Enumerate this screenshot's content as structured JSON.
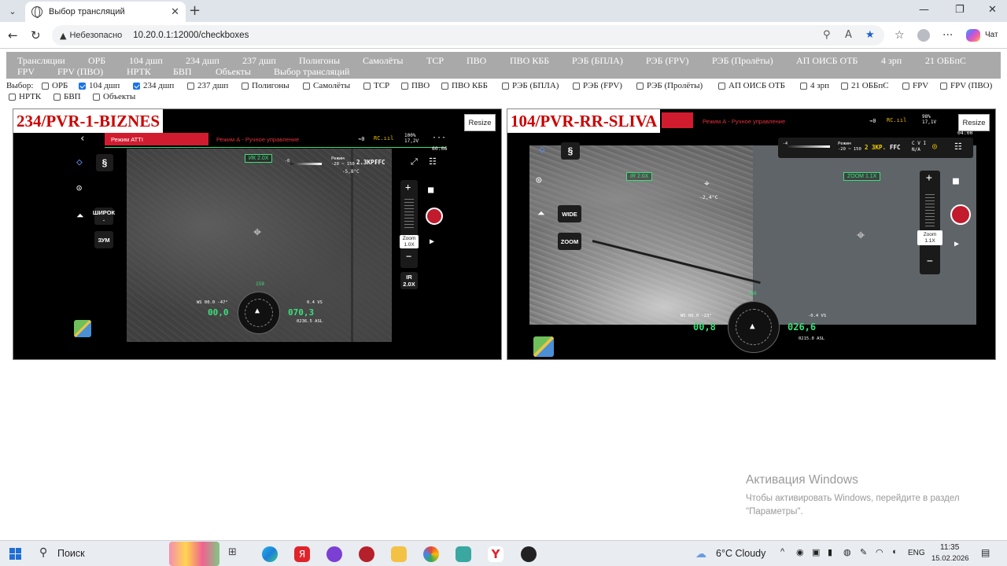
{
  "browser": {
    "tab_title": "Выбор трансляций",
    "insecure_label": "Небезопасно",
    "url": "10.20.0.1:12000/checkboxes",
    "chat_label": "Чат"
  },
  "nav_links": [
    "Трансляции",
    "ОРБ",
    "104 дшп",
    "234 дшп",
    "237 дшп",
    "Полигоны",
    "Самолёты",
    "ТСР",
    "ПВО",
    "ПВО КББ",
    "РЭБ (БПЛА)",
    "РЭБ (FPV)",
    "РЭБ (Пролёты)",
    "АП ОИСБ ОТБ",
    "4 зрп",
    "21 ОББпС",
    "FPV",
    "FPV (ПВО)",
    "НРТК",
    "БВП",
    "Объекты",
    "Выбор трансляций"
  ],
  "selection": {
    "label": "Выбор:",
    "items": [
      {
        "label": "ОРБ",
        "checked": false
      },
      {
        "label": "104 дшп",
        "checked": true
      },
      {
        "label": "234 дшп",
        "checked": true
      },
      {
        "label": "237 дшп",
        "checked": false
      },
      {
        "label": "Полигоны",
        "checked": false
      },
      {
        "label": "Самолёты",
        "checked": false
      },
      {
        "label": "ТСР",
        "checked": false
      },
      {
        "label": "ПВО",
        "checked": false
      },
      {
        "label": "ПВО КББ",
        "checked": false
      },
      {
        "label": "РЭБ (БПЛА)",
        "checked": false
      },
      {
        "label": "РЭБ (FPV)",
        "checked": false
      },
      {
        "label": "РЭБ (Пролёты)",
        "checked": false
      },
      {
        "label": "АП ОИСБ ОТБ",
        "checked": false
      },
      {
        "label": "4 зрп",
        "checked": false
      },
      {
        "label": "21 ОББпС",
        "checked": false
      },
      {
        "label": "FPV",
        "checked": false
      },
      {
        "label": "FPV (ПВО)",
        "checked": false
      },
      {
        "label": "НРТК",
        "checked": false
      },
      {
        "label": "БВП",
        "checked": false
      },
      {
        "label": "Объекты",
        "checked": false
      }
    ]
  },
  "streams": [
    {
      "title": "234/PVR-1-BIZNES",
      "resize_label": "Resize",
      "mode_atti": "Режим ATTI",
      "mode_manual": "Режим А - Ручное управление",
      "battery": "100%\n17,2V",
      "rc": "RC.ııl",
      "timer": "60:06",
      "ir_zoom": "ИК 2.0X",
      "range_label": "Режим\n-20 ~ 150",
      "zoom_2x": "2.ЗКР.",
      "ffc": "FFC",
      "temp": "-5,8°C",
      "wide_btn": "ШИРОК\n.",
      "zoom_btn": "ЗУМ",
      "zoom_label": "Zoom\n1.0X",
      "ir_level": "IR\n2.0X",
      "heading": "159",
      "ws": "WS 00.0   -47°",
      "hs": "00,0",
      "alt": "070,3",
      "vs": "0.4 VS",
      "asl": "0236.5 ASL"
    },
    {
      "title": "104/PVR-RR-SLIVA",
      "resize_label": "Resize",
      "mode_manual": "Режим А - Ручное управление",
      "battery": "98%\n17,1V",
      "rc": "RC.ııl",
      "timer": "04:00",
      "ir_zoom": "IR 2.0X",
      "range_label": "Режим\n-20 ~ 150",
      "zoom_2x": "2 ЗКР.",
      "ffc": "FFC",
      "cvi": "C V I\nN/A",
      "temp": "-2,4°C",
      "wide_btn": "WIDE",
      "zoom_btn": "ZOOM",
      "zoom_box": "ZOOM 1.1X",
      "zoom_label": "Zoom\n1.1X",
      "heading": "256",
      "ws": "WS 00.0   -23°",
      "hs": "00,8",
      "alt": "026,6",
      "vs": "-0.4 VS",
      "asl": "0215.0 ASL"
    }
  ],
  "windows": {
    "activation_title": "Активация Windows",
    "activation_text": "Чтобы активировать Windows, перейдите в раздел \"Параметры\"."
  },
  "taskbar": {
    "search_label": "Поиск",
    "weather": "6°C  Cloudy",
    "lang": "ENG",
    "time": "11:35",
    "date": "15.02.2026"
  },
  "colors": {
    "nav_bg": "#a9a9a9",
    "stream_title": "#cc0000",
    "mode_red": "#d11c2f",
    "hud_green": "#3ce07a"
  }
}
